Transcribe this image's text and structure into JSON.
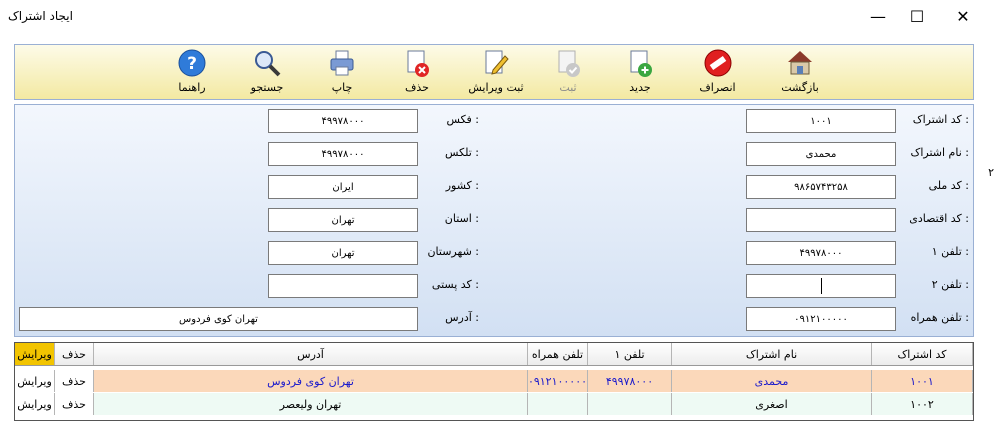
{
  "window": {
    "title": "ایجاد اشتراک",
    "minimize": "—",
    "maximize": "☐",
    "close": "✕"
  },
  "toolbar": {
    "back": "بازگشت",
    "cancel": "انصراف",
    "new": "جدید",
    "save": "ثبت",
    "save_edit": "ثبت ویرایش",
    "delete": "حذف",
    "print": "چاپ",
    "search": "جستجو",
    "help": "راهنما"
  },
  "form": {
    "sub_code": {
      "label": "کد اشتراک :",
      "value": "۱۰۰۱"
    },
    "sub_name": {
      "label": "نام اشتراک :",
      "value": "محمدی"
    },
    "national_code": {
      "label": "کد ملی :",
      "value": "۹۸۶۵۷۴۳۲۵۸"
    },
    "economic_code": {
      "label": "کد اقتصادی :",
      "value": ""
    },
    "phone1": {
      "label": "تلفن ۱ :",
      "value": "۴۹۹۷۸۰۰۰"
    },
    "phone2": {
      "label": "تلفن ۲ :",
      "value": ""
    },
    "mobile": {
      "label": "تلفن همراه :",
      "value": "۰۹۱۲۱۰۰۰۰۰"
    },
    "fax": {
      "label": "فکس :",
      "value": "۴۹۹۷۸۰۰۰"
    },
    "telex": {
      "label": "تلکس :",
      "value": "۴۹۹۷۸۰۰۰"
    },
    "country": {
      "label": "کشور :",
      "value": "ایران"
    },
    "province": {
      "label": "استان :",
      "value": "تهران"
    },
    "city": {
      "label": "شهرستان :",
      "value": "تهران"
    },
    "postal": {
      "label": "کد پستی :",
      "value": ""
    },
    "address": {
      "label": "آدرس :",
      "value": "تهران کوی فردوس"
    }
  },
  "grid": {
    "headers": {
      "code": "کد اشتراک",
      "name": "نام اشتراک",
      "phone1": "تلفن ۱",
      "mobile": "تلفن همراه",
      "address": "آدرس",
      "delete": "حذف",
      "edit": "ویرایش"
    },
    "rows": [
      {
        "code": "۱۰۰۱",
        "name": "محمدی",
        "phone1": "۴۹۹۷۸۰۰۰",
        "mobile": "۰۹۱۲۱۰۰۰۰۰",
        "address": "تهران کوی فردوس",
        "delete": "حذف",
        "edit": "ویرایش"
      },
      {
        "code": "۱۰۰۲",
        "name": "اصغری",
        "phone1": "",
        "mobile": "",
        "address": "تهران ولیعصر",
        "delete": "حذف",
        "edit": "ویرایش"
      }
    ]
  },
  "edge_fragment": "۲",
  "colors": {
    "toolbar_bg": "#f3e9a2",
    "form_bg": "#d2e0f3",
    "selected_row": "#fbd8ba",
    "data_text_blue": "#1a1acc"
  }
}
